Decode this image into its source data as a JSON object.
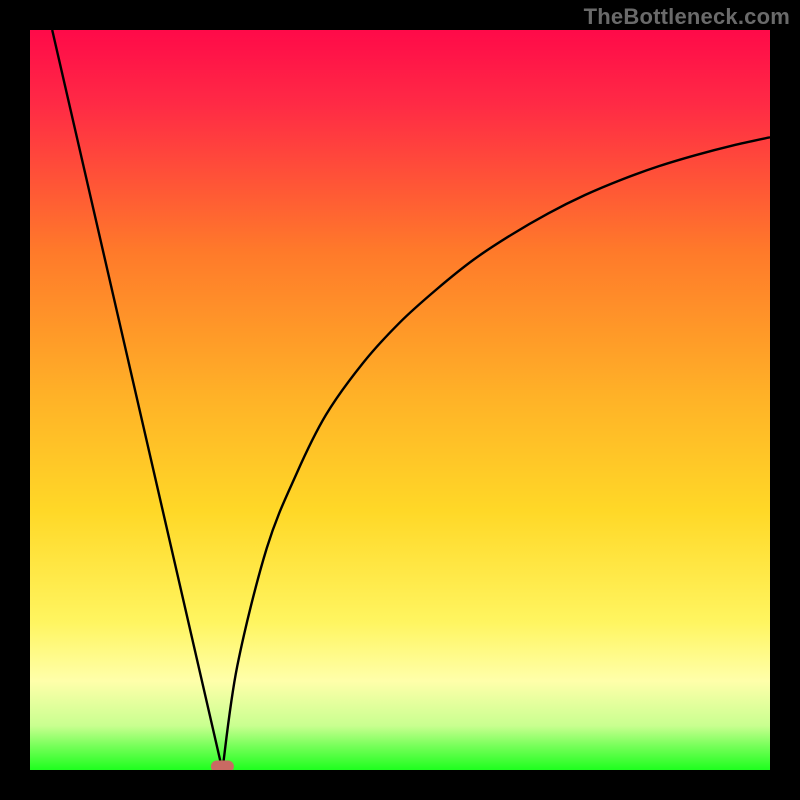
{
  "watermark": "TheBottleneck.com",
  "colors": {
    "frame": "#000000",
    "grad_top": "#ff0a49",
    "grad_mid1": "#ff6a2a",
    "grad_mid2": "#ffd827",
    "grad_pale": "#ffffaa",
    "grad_green": "#1eff1e",
    "curve": "#000000",
    "marker_fill": "#c96a63",
    "marker_stroke": "#c96a63"
  },
  "chart_data": {
    "type": "line",
    "title": "",
    "xlabel": "",
    "ylabel": "",
    "xlim": [
      0,
      100
    ],
    "ylim": [
      0,
      100
    ],
    "marker": {
      "x": 26,
      "y": 0
    },
    "left_segment": {
      "x": [
        3,
        26
      ],
      "y": [
        100,
        0
      ]
    },
    "right_curve": {
      "x": [
        26,
        28,
        32,
        36,
        40,
        45,
        50,
        55,
        60,
        65,
        70,
        75,
        80,
        85,
        90,
        95,
        100
      ],
      "y": [
        0,
        14,
        30,
        40,
        48,
        55,
        60.5,
        65,
        69,
        72.3,
        75.2,
        77.7,
        79.8,
        81.6,
        83.1,
        84.4,
        85.5
      ]
    },
    "annotations": []
  }
}
